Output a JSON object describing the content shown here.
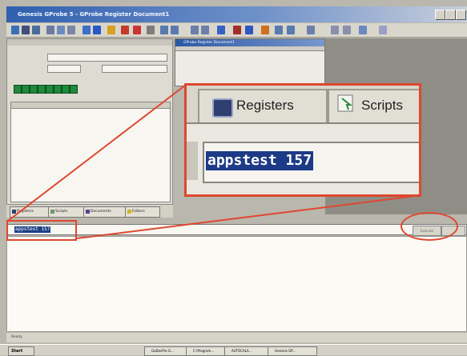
{
  "window": {
    "title": "Genesis GProbe 5 - GProbe Register Document1"
  },
  "colors": {
    "highlight": "#e0472f",
    "title_bar": "#2f5fae",
    "cmd_selection": "#1d3f86"
  },
  "toolbar": {
    "icons": [
      "new-icon",
      "open-icon",
      "save-icon",
      "cut-icon",
      "copy-icon",
      "paste-icon",
      "bookmark-icon",
      "info-icon",
      "search-icon",
      "print-icon",
      "help-icon"
    ]
  },
  "register_panel": {
    "bits": [
      0,
      0,
      0,
      0,
      0,
      0,
      0,
      0
    ]
  },
  "tabs": [
    {
      "label": "Registers",
      "icon": "registers-icon"
    },
    {
      "label": "Scripts",
      "icon": "scripts-icon"
    },
    {
      "label": "Documents",
      "icon": "documents-icon"
    },
    {
      "label": "Editors",
      "icon": "editors-icon"
    }
  ],
  "doc_window": {
    "title": "GProbe Register Document1"
  },
  "command": {
    "text": "appstest 157",
    "execute_label": "Execute"
  },
  "zoom": {
    "tab_registers": "Registers",
    "tab_scripts": "Scripts",
    "command_text": "appstest 157"
  },
  "status": {
    "text": "Ready"
  },
  "taskbar": {
    "start": "Start",
    "tasks": [
      "GoDocPro G...",
      "C:\\Program...",
      "AUTOCALS...",
      "Genesis GP..."
    ]
  }
}
